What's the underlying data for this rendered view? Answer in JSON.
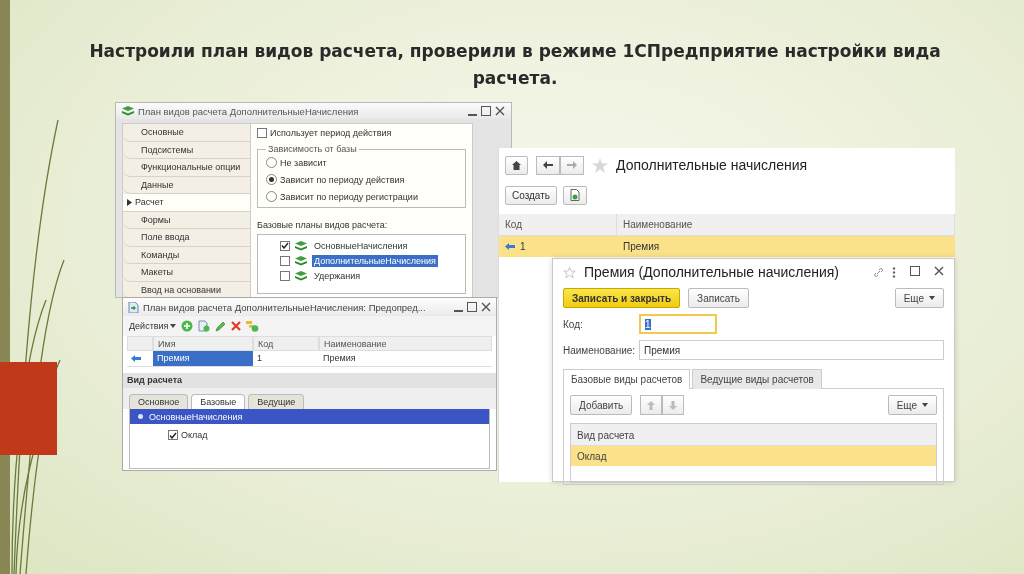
{
  "slide": {
    "title": "Настроили план видов расчета, проверили в режиме 1СПредприятие настройки вида расчета."
  },
  "config_window": {
    "title": "План видов расчета ДополнительныеНачисления",
    "sections": [
      {
        "label": "Основные",
        "selected": false
      },
      {
        "label": "Подсистемы",
        "selected": false
      },
      {
        "label": "Функциональные опции",
        "selected": false
      },
      {
        "label": "Данные",
        "selected": false
      },
      {
        "label": "Расчет",
        "selected": true
      },
      {
        "label": "Формы",
        "selected": false
      },
      {
        "label": "Поле ввода",
        "selected": false
      },
      {
        "label": "Команды",
        "selected": false
      },
      {
        "label": "Макеты",
        "selected": false
      },
      {
        "label": "Ввод на основании",
        "selected": false
      }
    ],
    "uses_period": {
      "label": "Использует период действия",
      "checked": false
    },
    "dependency": {
      "title": "Зависимость от базы",
      "options": [
        {
          "label": "Не зависит",
          "selected": false
        },
        {
          "label": "Зависит по периоду действия",
          "selected": true
        },
        {
          "label": "Зависит по периоду регистрации",
          "selected": false
        }
      ]
    },
    "base_plans": {
      "label": "Базовые планы видов расчета:",
      "items": [
        {
          "label": "ОсновныеНачисления",
          "checked": true,
          "selected": false
        },
        {
          "label": "ДополнительныеНачисления",
          "checked": false,
          "selected": true
        },
        {
          "label": "Удержания",
          "checked": false,
          "selected": false
        }
      ]
    }
  },
  "predefined_window": {
    "title": "План видов расчета ДополнительныеНачисления: Предопред...",
    "actions": "Действия",
    "columns": [
      "Имя",
      "Код",
      "Наименование"
    ],
    "rows": [
      {
        "cells": [
          "Премия",
          "1",
          "Премия"
        ],
        "selected": true
      }
    ],
    "section_title": "Вид расчета",
    "tabs": [
      {
        "label": "Основное",
        "selected": false
      },
      {
        "label": "Базовые",
        "selected": true
      },
      {
        "label": "Ведущие",
        "selected": false
      }
    ],
    "tree": [
      {
        "label": "ОсновныеНачисления",
        "selected": true,
        "children": [
          {
            "label": "Оклад",
            "checked": true
          }
        ]
      }
    ]
  },
  "list_window": {
    "title": "Дополнительные начисления",
    "create_button": "Создать",
    "columns": [
      "Код",
      "Наименование"
    ],
    "rows": [
      {
        "cells": [
          "1",
          "Премия"
        ],
        "selected": true
      }
    ]
  },
  "item_dialog": {
    "title": "Премия (Дополнительные начисления)",
    "save_close_button": "Записать и закрыть",
    "save_button": "Записать",
    "more_button": "Еще",
    "fields": [
      {
        "label": "Код:",
        "value": "1",
        "focused": true
      },
      {
        "label": "Наименование:",
        "value": "Премия",
        "focused": false
      }
    ],
    "tabs": [
      {
        "label": "Базовые виды расчетов",
        "selected": true
      },
      {
        "label": "Ведущие виды расчетов",
        "selected": false
      }
    ],
    "add_button": "Добавить",
    "table_more_button": "Еще",
    "columns": [
      "Вид расчета"
    ],
    "rows": [
      {
        "cells": [
          "Оклад"
        ],
        "selected": true
      }
    ]
  }
}
